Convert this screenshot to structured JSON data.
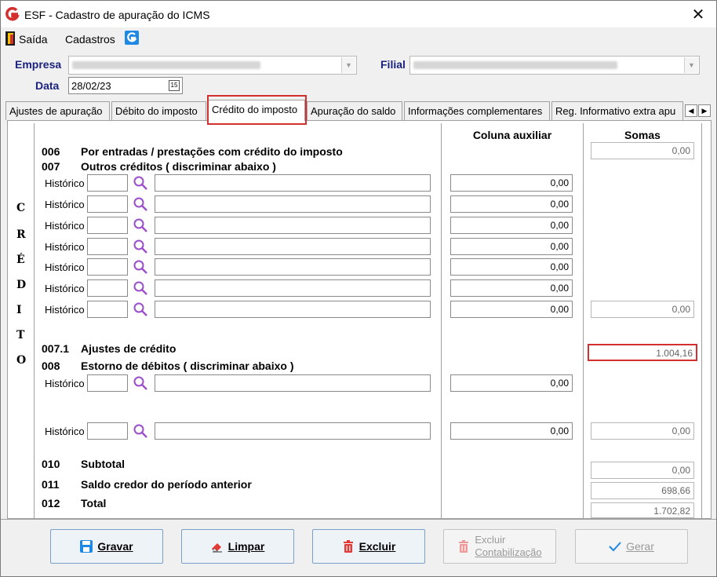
{
  "window": {
    "title": "ESF - Cadastro de apuração do ICMS",
    "close_symbol": "✕"
  },
  "menu": {
    "items": [
      "Saída",
      "Cadastros"
    ]
  },
  "header": {
    "empresa_label": "Empresa",
    "filial_label": "Filial",
    "data_label": "Data",
    "data_value": "28/02/23",
    "calendar_text": "15"
  },
  "tabs": [
    "Ajustes de apuração",
    "Débito do imposto",
    "Crédito do imposto",
    "Apuração do saldo",
    "Informações complementares",
    "Reg. Informativo extra apu"
  ],
  "active_tab": "Crédito do imposto",
  "section": {
    "vertical_label": [
      "C",
      "R",
      "É",
      "D",
      "I",
      "T",
      "O"
    ],
    "col_aux": "Coluna auxiliar",
    "col_somas": "Somas",
    "lines": {
      "l006_code": "006",
      "l006_text": "Por entradas / prestações com crédito do imposto",
      "l007_code": "007",
      "l007_text": "Outros créditos ( discriminar abaixo )",
      "l0071_code": "007.1",
      "l0071_text": "Ajustes de crédito",
      "l008_code": "008",
      "l008_text": "Estorno de débitos ( discriminar abaixo )",
      "l010_code": "010",
      "l010_text": "Subtotal",
      "l011_code": "011",
      "l011_text": "Saldo credor do período anterior",
      "l012_code": "012",
      "l012_text": "Total"
    },
    "historico_label": "Histórico",
    "aux_values_007": [
      "0,00",
      "0,00",
      "0,00",
      "0,00",
      "0,00",
      "0,00",
      "0,00"
    ],
    "aux_values_008": [
      "0,00",
      "0,00"
    ],
    "somas": {
      "s006": "0,00",
      "s007": "0,00",
      "s0071": "1.004,16",
      "s008": "0,00",
      "s010": "0,00",
      "s011": "698,66",
      "s012": "1.702,82"
    }
  },
  "buttons": {
    "gravar": "Gravar",
    "limpar": "Limpar",
    "excluir": "Excluir",
    "excluir_contab_1": "Excluir",
    "excluir_contab_2": "Contabilização",
    "gerar": "Gerar"
  },
  "colors": {
    "label_blue": "#1a237e",
    "highlight_red": "#d32f2f",
    "search_purple": "#9c4dcc"
  }
}
